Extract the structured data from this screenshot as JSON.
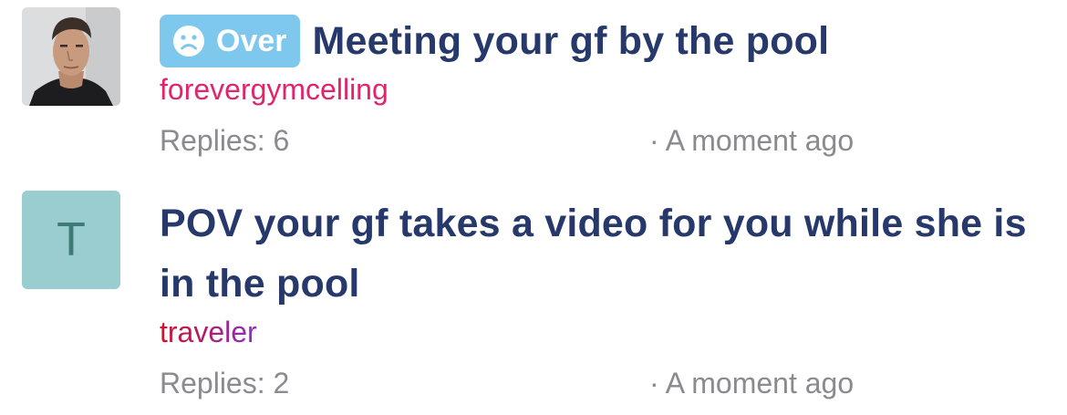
{
  "threads": [
    {
      "badge": {
        "label": "Over",
        "icon": "sad-face-icon",
        "color": "#7ec8ee"
      },
      "title": "Meeting your gf by the pool",
      "author": "forevergymcelling",
      "author_color": "#e3246c",
      "replies": "Replies: 6",
      "time": "· A moment ago",
      "avatar": {
        "type": "photo"
      }
    },
    {
      "title": "POV your gf takes a video for you while she is in the pool",
      "author": "traveler",
      "author_color": "gradient red-purple",
      "replies": "Replies: 2",
      "time": "· A moment ago",
      "avatar": {
        "type": "letter",
        "letter": "T",
        "color": "#99cdd0"
      }
    }
  ]
}
